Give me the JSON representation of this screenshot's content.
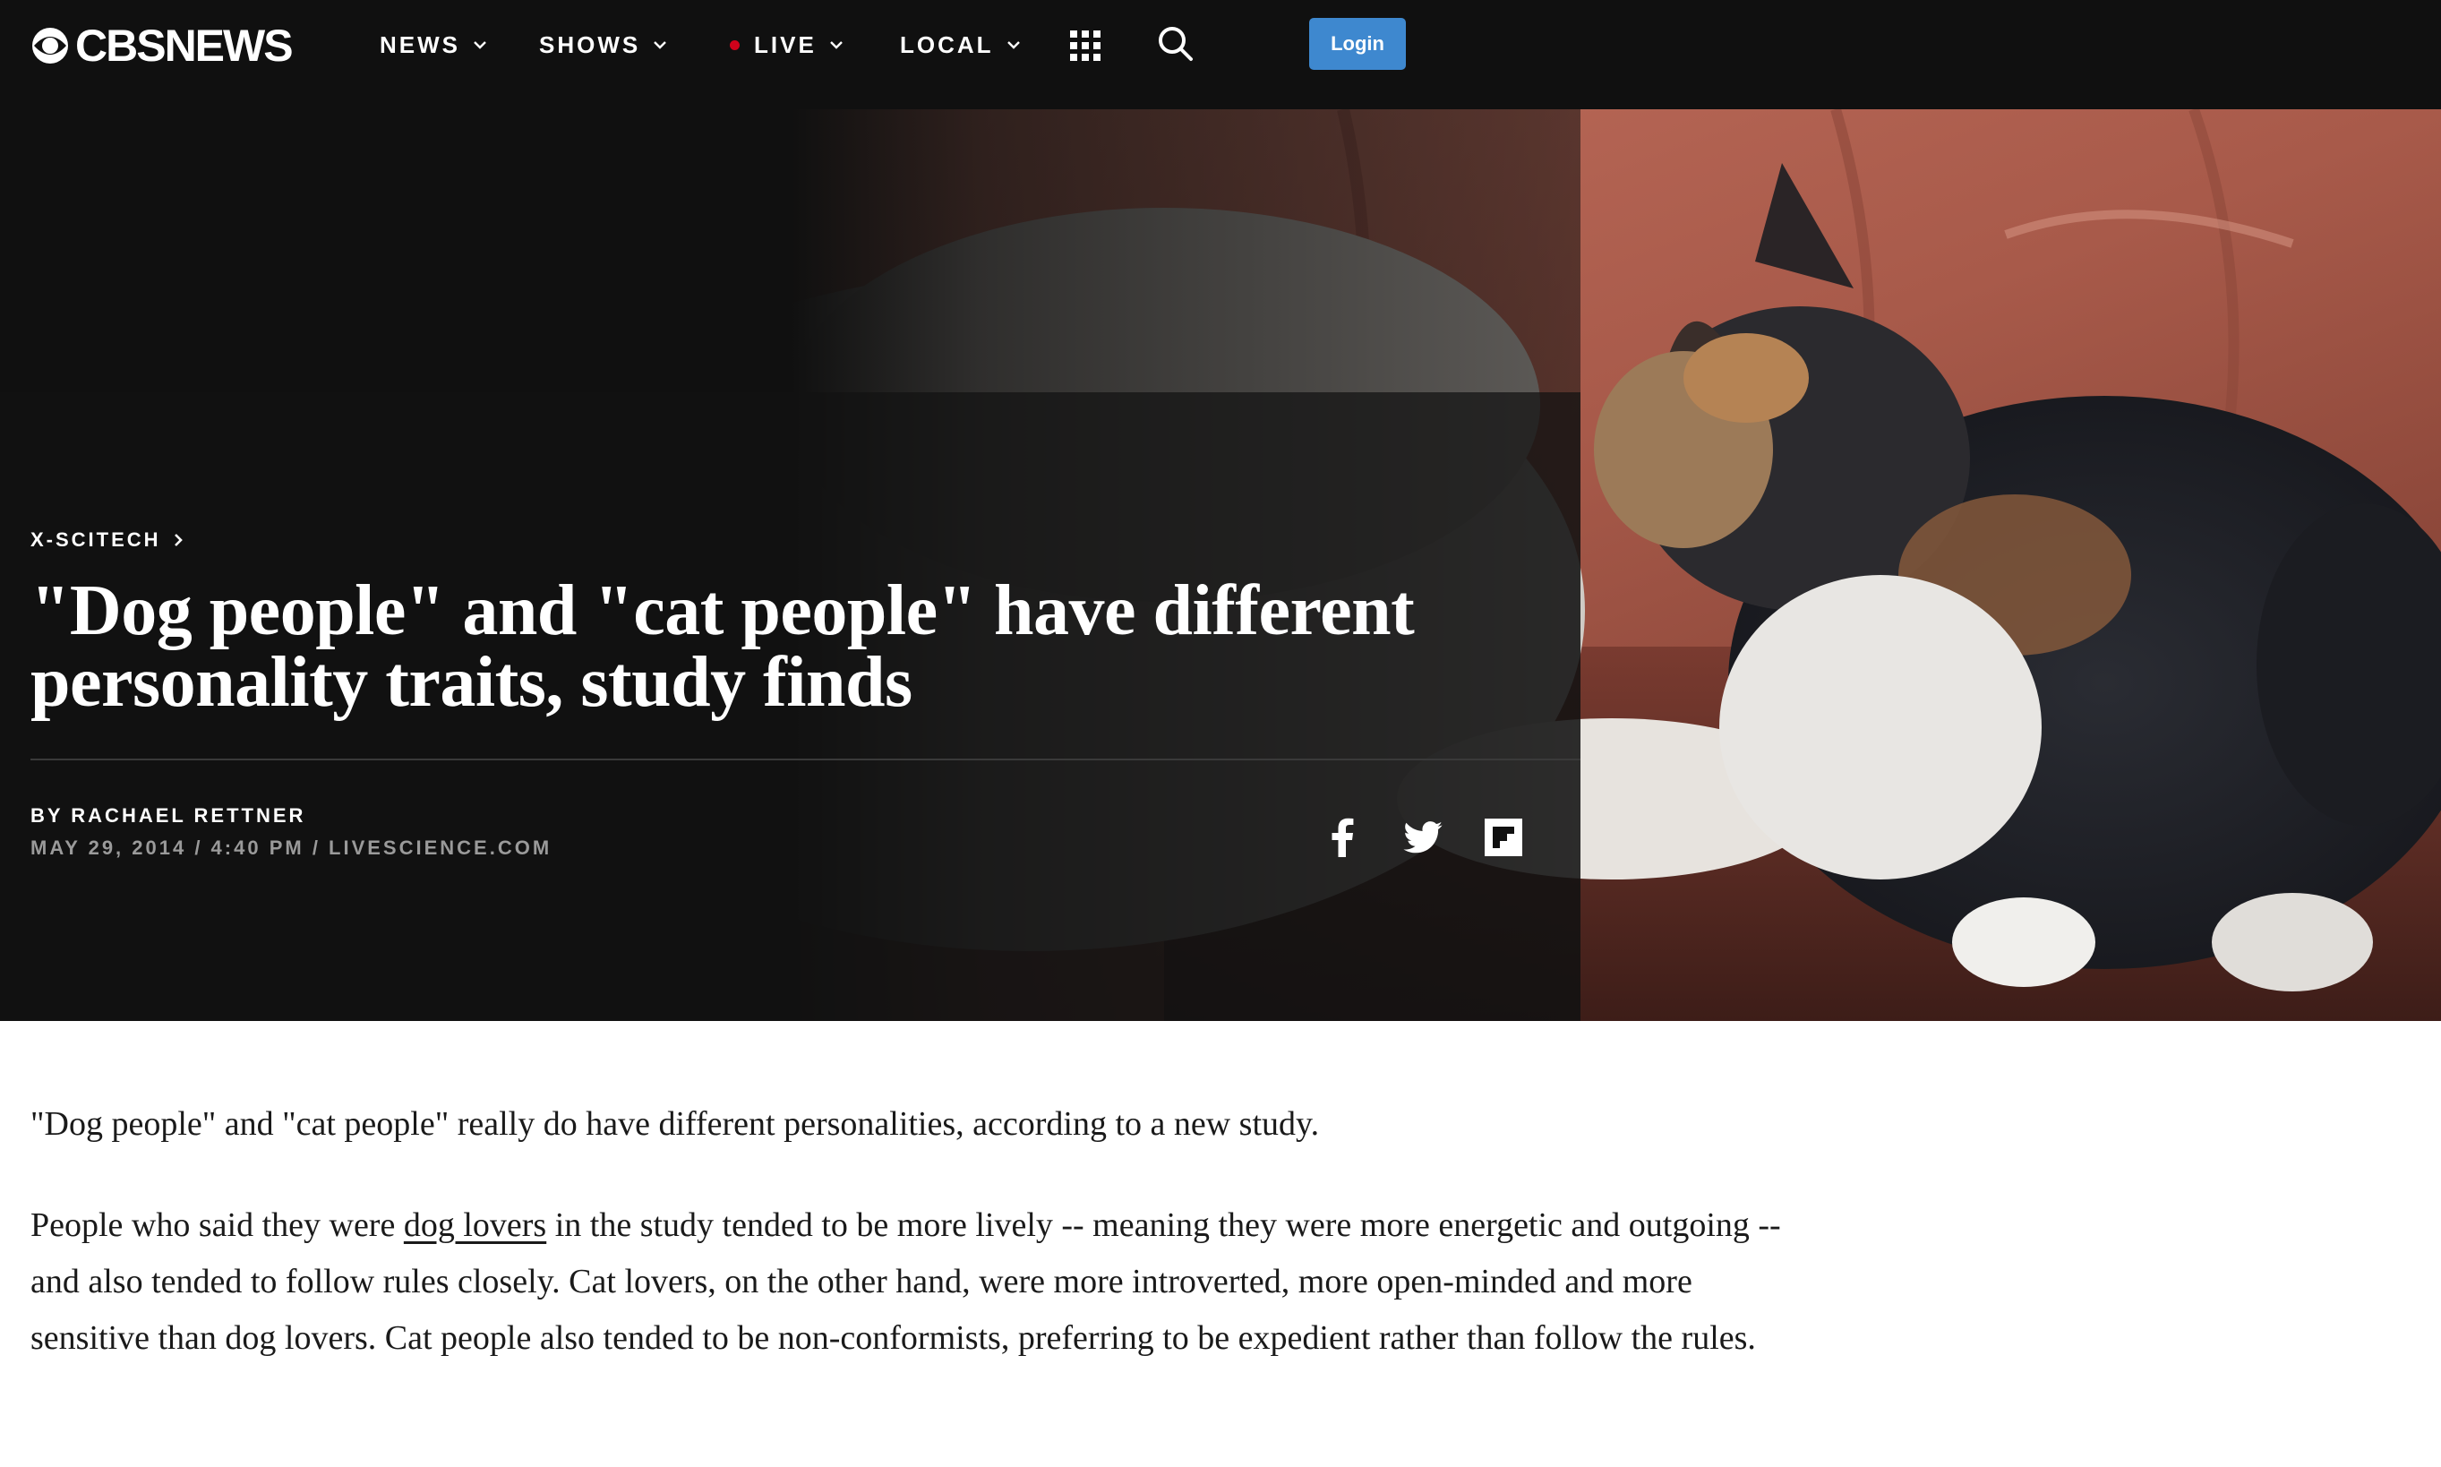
{
  "brand": {
    "logo_text": "CBSNEWS"
  },
  "nav": {
    "items": [
      {
        "label": "NEWS"
      },
      {
        "label": "SHOWS"
      },
      {
        "label": "LIVE"
      },
      {
        "label": "LOCAL"
      }
    ],
    "login_label": "Login"
  },
  "icons": {
    "logo": "cbs-eye-icon",
    "menu": "grid-icon",
    "search": "search-icon",
    "share": [
      "facebook-icon",
      "twitter-icon",
      "flipboard-icon"
    ]
  },
  "colors": {
    "nav_background": "#101010",
    "login_button": "#3e88cf",
    "live_dot": "#d0021b"
  },
  "article": {
    "category": "X-SCITECH",
    "headline": "\"Dog people\" and \"cat people\" have different personality traits, study finds",
    "byline": "BY RACHAEL RETTNER",
    "dateline": "MAY 29, 2014 / 4:40 PM / LIVESCIENCE.COM",
    "paragraph_1": "\"Dog people\" and \"cat people\" really do have different personalities, according to a new study.",
    "paragraph_2_before": "People who said they were ",
    "paragraph_2_link": "dog lovers",
    "paragraph_2_after": " in the study tended to be more lively -- meaning they were more energetic and outgoing -- and also tended to follow rules closely. Cat lovers, on the other hand, were more introverted, more open-minded and more sensitive than dog lovers. Cat people also tended to be non-conformists, preferring to be expedient rather than follow the rules."
  }
}
